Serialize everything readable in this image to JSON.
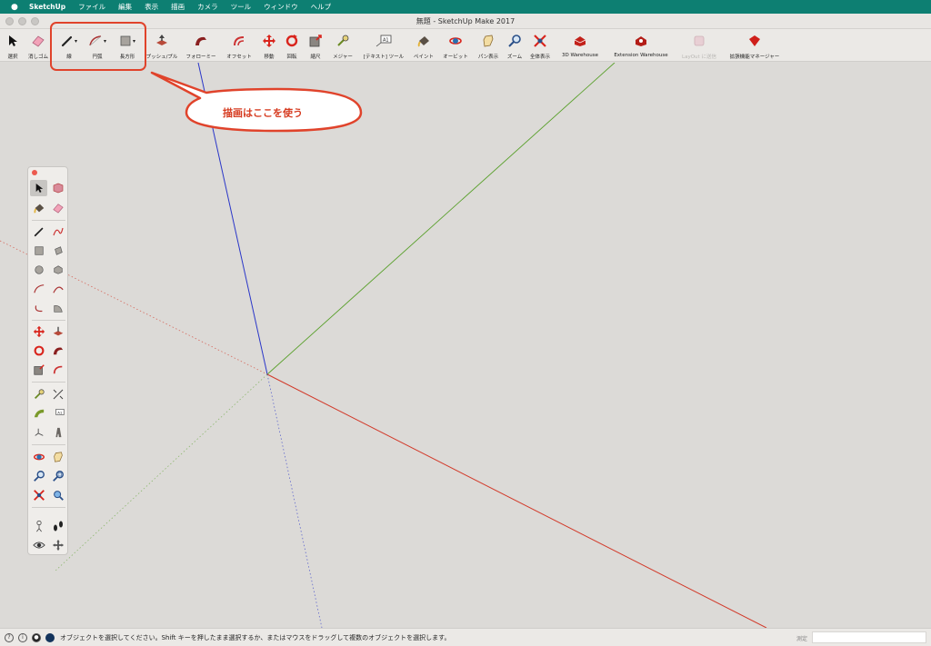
{
  "menubar": {
    "app": "SketchUp",
    "items": [
      "ファイル",
      "編集",
      "表示",
      "描画",
      "カメラ",
      "ツール",
      "ウィンドウ",
      "ヘルプ"
    ]
  },
  "window": {
    "title": "無題 - SketchUp Make 2017"
  },
  "toolbar": {
    "select": "選択",
    "eraser": "消しゴム",
    "line": "線",
    "arc": "円弧",
    "rectangle": "長方形",
    "pushpull": "プッシュ/プル",
    "followme": "フォローミー",
    "offset": "オフセット",
    "move": "移動",
    "rotate": "回転",
    "scale": "縮尺",
    "tape": "メジャー",
    "text": "[テキスト] ツール",
    "paint": "ペイント",
    "orbit": "オービット",
    "pan": "パン表示",
    "zoom": "ズーム",
    "zoom_extents": "全体表示",
    "warehouse": "3D Warehouse",
    "extension_warehouse": "Extension Warehouse",
    "layout": "LayOut に送信",
    "extension_manager": "拡張機能マネージャー"
  },
  "callout": {
    "text": "描画はここを使う"
  },
  "status": {
    "message": "オブジェクトを選択してください。Shift キーを押したまま選択するか、またはマウスをドラッグして複数のオブジェクトを選択します。",
    "measure_label": "測定"
  },
  "colors": {
    "accent_red": "#e0432b",
    "menubar": "#0d7f72",
    "axis_red": "#d23a2a",
    "axis_green": "#5aa02c",
    "axis_blue": "#2a36c8"
  }
}
